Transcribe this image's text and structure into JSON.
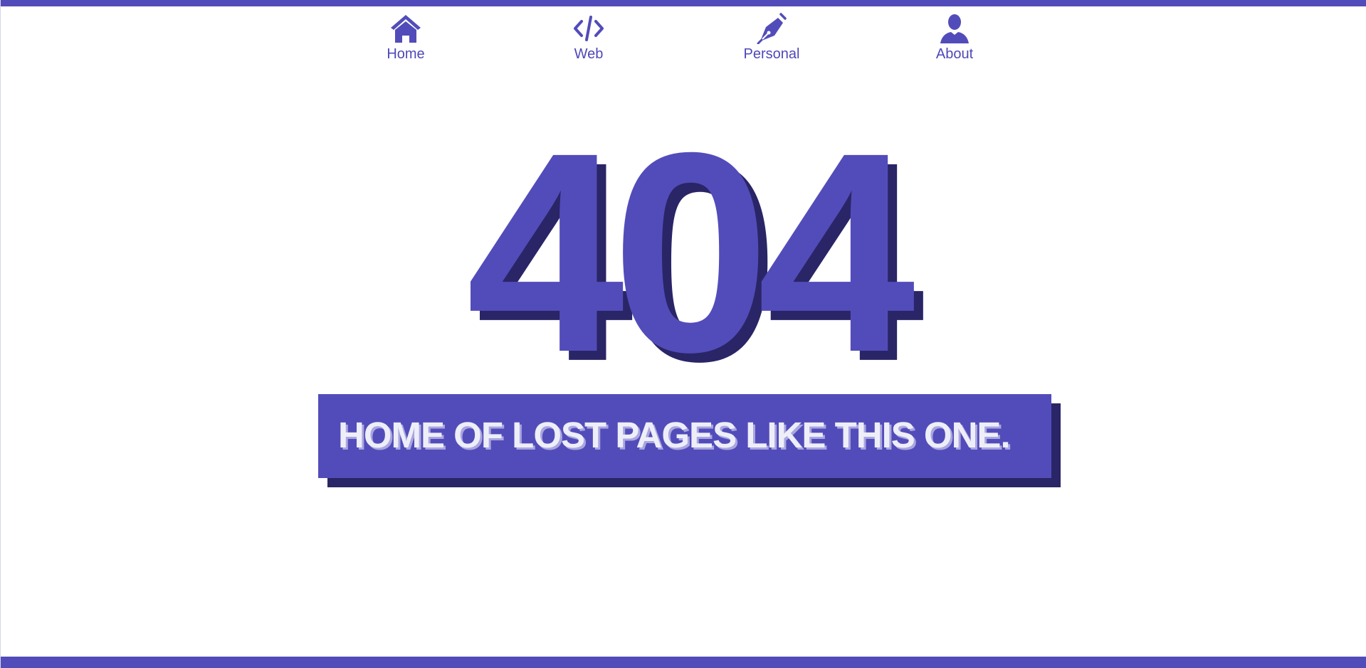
{
  "nav": {
    "items": [
      {
        "label": "Home",
        "icon": "home-icon"
      },
      {
        "label": "Web",
        "icon": "code-icon"
      },
      {
        "label": "Personal",
        "icon": "pen-nib-icon"
      },
      {
        "label": "About",
        "icon": "user-icon"
      }
    ]
  },
  "hero": {
    "code": "404",
    "message": "HOME OF LOST PAGES LIKE THIS ONE."
  },
  "colors": {
    "accent": "#524cba",
    "accent_dark": "#2a2566",
    "text_light": "#eeeef8"
  }
}
